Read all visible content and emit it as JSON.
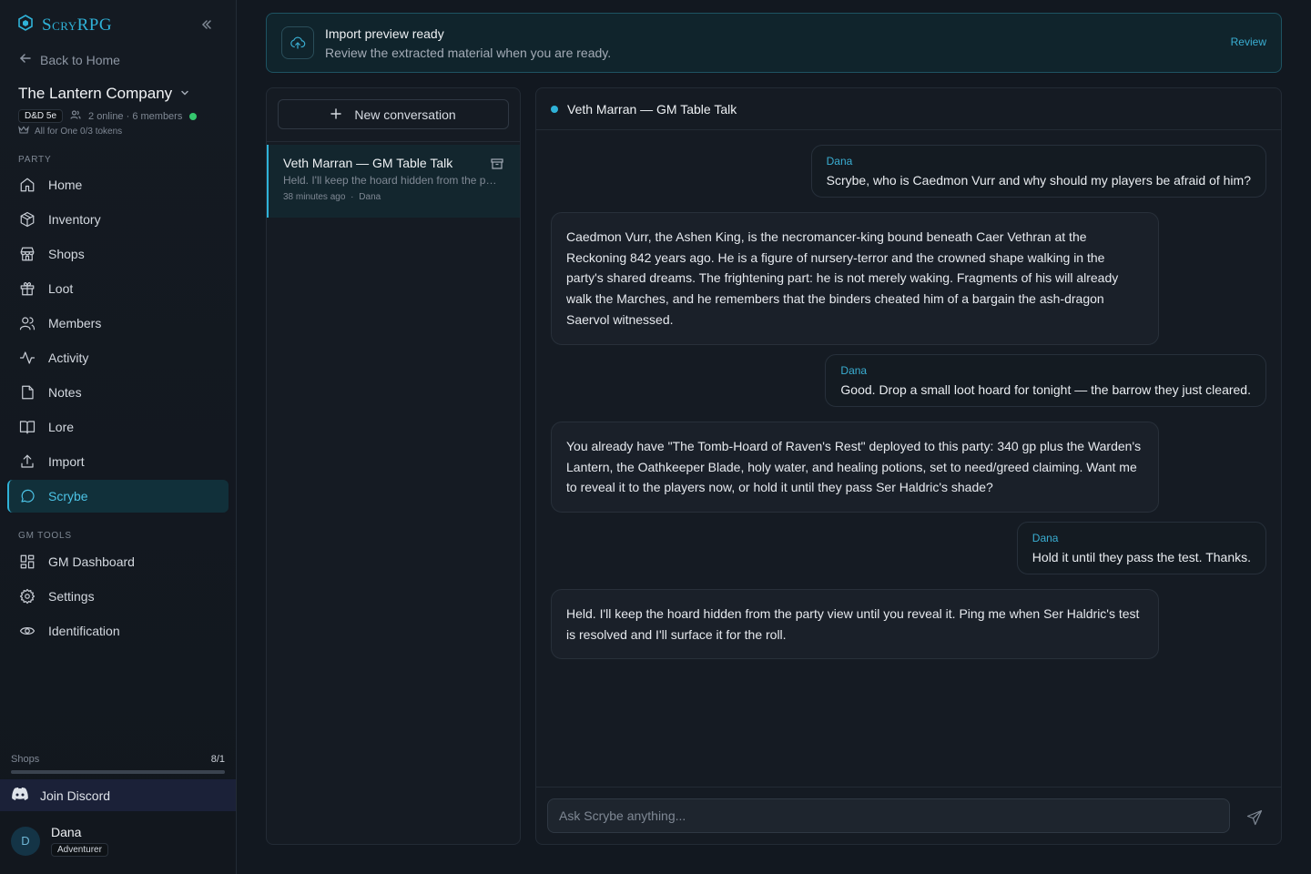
{
  "sidebar": {
    "brand": "ScryRPG",
    "back_label": "Back to Home",
    "party_name": "The Lantern Company",
    "system_badge": "D&D 5e",
    "online_text": "2 online · 6 members",
    "tokens_text": "All for One 0/3 tokens",
    "party_section": "PARTY",
    "party_items": [
      {
        "label": "Home",
        "icon": "home-icon"
      },
      {
        "label": "Inventory",
        "icon": "box-icon"
      },
      {
        "label": "Shops",
        "icon": "store-icon"
      },
      {
        "label": "Loot",
        "icon": "gift-icon"
      },
      {
        "label": "Members",
        "icon": "users-icon"
      },
      {
        "label": "Activity",
        "icon": "activity-icon"
      },
      {
        "label": "Notes",
        "icon": "note-icon"
      },
      {
        "label": "Lore",
        "icon": "book-icon"
      },
      {
        "label": "Import",
        "icon": "upload-icon"
      },
      {
        "label": "Scrybe",
        "icon": "chat-icon",
        "active": true
      }
    ],
    "gm_section": "GM TOOLS",
    "gm_items": [
      {
        "label": "GM Dashboard",
        "icon": "dashboard-icon"
      },
      {
        "label": "Settings",
        "icon": "gear-icon"
      },
      {
        "label": "Identification",
        "icon": "eye-icon"
      }
    ],
    "shops_label": "Shops",
    "shops_count": "8/1",
    "shops_progress": 1.0,
    "discord_label": "Join Discord",
    "user_initial": "D",
    "user_name": "Dana",
    "user_role": "Adventurer"
  },
  "banner": {
    "title": "Import preview ready",
    "subtitle": "Review the extracted material when you are ready.",
    "action": "Review"
  },
  "conversations": {
    "new_label": "New conversation",
    "items": [
      {
        "title": "Veth Marran — GM Table Talk",
        "preview": "Held. I'll keep the hoard hidden from the party view until you reveal it.",
        "time": "38 minutes ago",
        "author": "Dana"
      }
    ]
  },
  "chat": {
    "title": "Veth Marran — GM Table Talk",
    "messages": [
      {
        "role": "user",
        "from": "Dana",
        "text": "Scrybe, who is Caedmon Vurr and why should my players be afraid of him?"
      },
      {
        "role": "bot",
        "text": "Caedmon Vurr, the Ashen King, is the necromancer-king bound beneath Caer Vethran at the Reckoning 842 years ago. He is a figure of nursery-terror and the crowned shape walking in the party's shared dreams. The frightening part: he is not merely waking. Fragments of his will already walk the Marches, and he remembers that the binders cheated him of a bargain the ash-dragon Saervol witnessed."
      },
      {
        "role": "user",
        "from": "Dana",
        "text": "Good. Drop a small loot hoard for tonight — the barrow they just cleared."
      },
      {
        "role": "bot",
        "text": "You already have \"The Tomb-Hoard of Raven's Rest\" deployed to this party: 340 gp plus the Warden's Lantern, the Oathkeeper Blade, holy water, and healing potions, set to need/greed claiming. Want me to reveal it to the players now, or hold it until they pass Ser Haldric's shade?"
      },
      {
        "role": "user",
        "from": "Dana",
        "text": "Hold it until they pass the test. Thanks."
      },
      {
        "role": "bot",
        "text": "Held. I'll keep the hoard hidden from the party view until you reveal it. Ping me when Ser Haldric's test is resolved and I'll surface it for the roll."
      }
    ],
    "input_placeholder": "Ask Scrybe anything..."
  }
}
